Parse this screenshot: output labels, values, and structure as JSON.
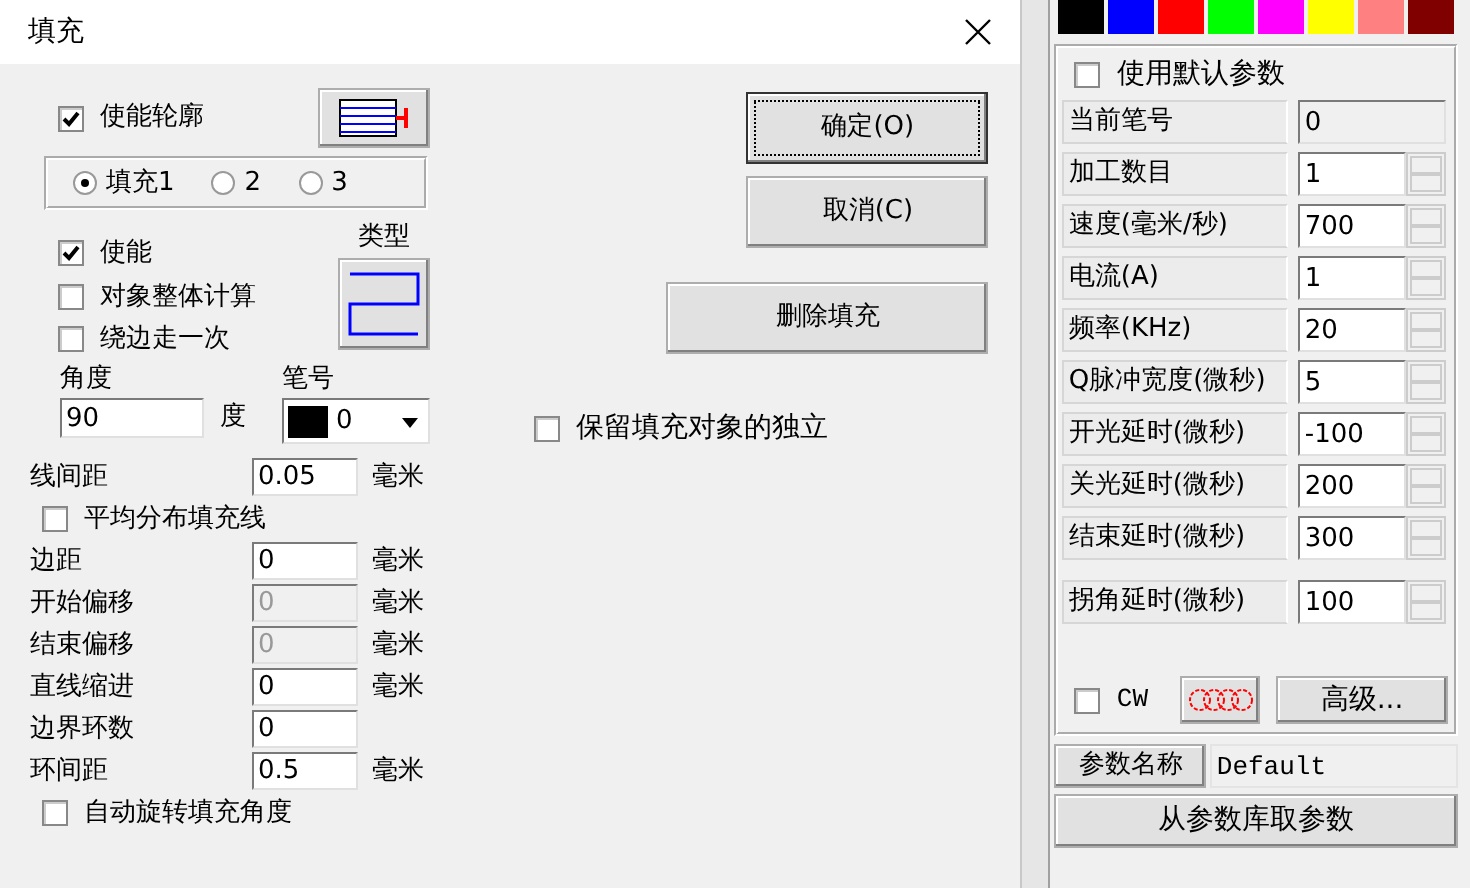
{
  "window": {
    "title": "填充"
  },
  "outline": {
    "label": "使能轮廓",
    "checked": true
  },
  "fill_tabs": [
    {
      "label": "填充1",
      "selected": true
    },
    {
      "label": "2",
      "selected": false
    },
    {
      "label": "3",
      "selected": false
    }
  ],
  "options": [
    {
      "label": "使能",
      "checked": true
    },
    {
      "label": "对象整体计算",
      "checked": false
    },
    {
      "label": "绕边走一次",
      "checked": false
    }
  ],
  "type_label": "类型",
  "angle": {
    "label": "角度",
    "value": "90",
    "unit": "度"
  },
  "pen": {
    "label": "笔号",
    "value": "0",
    "color": "#000000"
  },
  "params": [
    {
      "kind": "field",
      "label": "线间距",
      "value": "0.05",
      "unit": "毫米",
      "disabled": false
    },
    {
      "kind": "checkbox",
      "label": "平均分布填充线",
      "checked": false
    },
    {
      "kind": "field",
      "label": "边距",
      "value": "0",
      "unit": "毫米",
      "disabled": false
    },
    {
      "kind": "field",
      "label": "开始偏移",
      "value": "0",
      "unit": "毫米",
      "disabled": true
    },
    {
      "kind": "field",
      "label": "结束偏移",
      "value": "0",
      "unit": "毫米",
      "disabled": true
    },
    {
      "kind": "field",
      "label": "直线缩进",
      "value": "0",
      "unit": "毫米",
      "disabled": false
    },
    {
      "kind": "field",
      "label": "边界环数",
      "value": "0",
      "disabled": false
    },
    {
      "kind": "field",
      "label": "环间距",
      "value": "0.5",
      "unit": "毫米",
      "disabled": false
    },
    {
      "kind": "checkbox",
      "label": "自动旋转填充角度",
      "checked": false
    }
  ],
  "buttons": [
    {
      "label": "确定(O)",
      "focused": true
    },
    {
      "label": "取消(C)",
      "focused": false
    }
  ],
  "delete_button": "删除填充",
  "keep_independent": {
    "label": "保留填充对象的独立",
    "checked": false
  },
  "pen_colors": [
    {
      "color": "#000000"
    },
    {
      "color": "#0000ff"
    },
    {
      "color": "#ff0000"
    },
    {
      "color": "#00ff00"
    },
    {
      "color": "#ff00ff"
    },
    {
      "color": "#ffff00"
    },
    {
      "color": "#ff8080"
    },
    {
      "color": "#800000"
    }
  ],
  "use_default": {
    "label": "使用默认参数",
    "checked": false
  },
  "laser_params": [
    {
      "kind": "readonly",
      "label": "当前笔号",
      "value": "0"
    },
    {
      "kind": "spin",
      "label": "加工数目",
      "value": "1"
    },
    {
      "kind": "spin",
      "label": "速度(毫米/秒)",
      "value": "700"
    },
    {
      "kind": "spin",
      "label": "电流(A)",
      "value": "1"
    },
    {
      "kind": "spin",
      "label": "频率(KHz)",
      "value": "20"
    },
    {
      "kind": "spin",
      "label": "Q脉冲宽度(微秒)",
      "value": "5"
    },
    {
      "kind": "spin",
      "label": "开光延时(微秒)",
      "value": "-100"
    },
    {
      "kind": "spin",
      "label": "关光延时(微秒)",
      "value": "200"
    },
    {
      "kind": "spin",
      "label": "结束延时(微秒)",
      "value": "300"
    },
    {
      "kind": "spin",
      "label": "拐角延时(微秒)",
      "value": "100"
    }
  ],
  "cw": {
    "label": "CW",
    "checked": false
  },
  "advanced_button": "高级...",
  "param_name": {
    "label": "参数名称",
    "value": "Default"
  },
  "load_button": "从参数库取参数"
}
